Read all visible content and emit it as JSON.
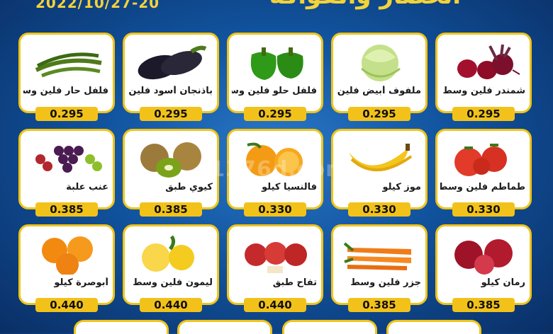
{
  "header": {
    "date": "2022/10/27-20",
    "title": "الخضار والفواكه"
  },
  "watermark": "e1376d.com",
  "products": [
    {
      "name": "شمندر فلين وسط",
      "price": "0.295",
      "icon": "beetroot-icon"
    },
    {
      "name": "ملفوف أبيض فلين وسط",
      "price": "0.295",
      "icon": "cabbage-icon"
    },
    {
      "name": "فلفل حلو فلين وسط",
      "price": "0.295",
      "icon": "bell-pepper-icon"
    },
    {
      "name": "باذنجان أسود فلين وسط",
      "price": "0.295",
      "icon": "eggplant-icon"
    },
    {
      "name": "فلفل حار فلين وسط",
      "price": "0.295",
      "icon": "chili-pepper-icon"
    },
    {
      "name": "طماطم فلين وسط",
      "price": "0.330",
      "icon": "tomato-icon"
    },
    {
      "name": "موز كيلو",
      "price": "0.330",
      "icon": "banana-icon"
    },
    {
      "name": "فالنسيا كيلو",
      "price": "0.330",
      "icon": "orange-icon"
    },
    {
      "name": "كيوي طبق",
      "price": "0.385",
      "icon": "kiwi-icon"
    },
    {
      "name": "عنب علبة",
      "price": "0.385",
      "icon": "grapes-icon"
    },
    {
      "name": "رمان كيلو",
      "price": "0.385",
      "icon": "pomegranate-icon"
    },
    {
      "name": "جزر فلين وسط",
      "price": "0.385",
      "icon": "carrot-icon"
    },
    {
      "name": "تفاح طبق",
      "price": "0.440",
      "icon": "apple-icon"
    },
    {
      "name": "ليمون فلين وسط",
      "price": "0.440",
      "icon": "lemon-icon"
    },
    {
      "name": "أبوصرة كيلو",
      "price": "0.440",
      "icon": "navel-orange-icon"
    }
  ]
}
